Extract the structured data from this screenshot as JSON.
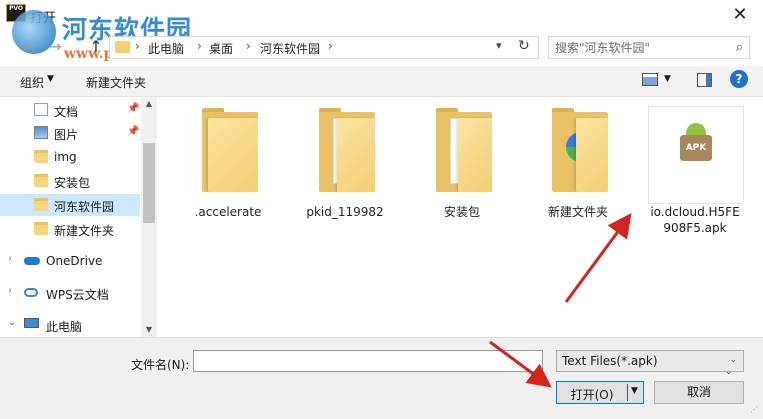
{
  "window": {
    "title": "打开",
    "app_icon_text": "PVO"
  },
  "watermark": {
    "site_name": "河东软件园",
    "url": "www.pc0359.cn"
  },
  "address": {
    "crumbs": [
      "此电脑",
      "桌面",
      "河东软件园"
    ]
  },
  "search": {
    "placeholder": "搜索\"河东软件园\""
  },
  "toolbar": {
    "organize_label": "组织",
    "new_folder_label": "新建文件夹"
  },
  "nav": {
    "items": [
      {
        "label": "文档",
        "icon": "document-icon",
        "pinned": true
      },
      {
        "label": "图片",
        "icon": "picture-icon",
        "pinned": true
      },
      {
        "label": "img",
        "icon": "folder-icon"
      },
      {
        "label": "安装包",
        "icon": "folder-icon"
      },
      {
        "label": "河东软件园",
        "icon": "folder-icon",
        "selected": true
      },
      {
        "label": "新建文件夹",
        "icon": "folder-icon"
      },
      {
        "label": "OneDrive",
        "icon": "cloud-icon"
      },
      {
        "label": "WPS云文档",
        "icon": "cloud-icon"
      },
      {
        "label": "此电脑",
        "icon": "computer-icon"
      }
    ]
  },
  "files": [
    {
      "name": ".accelerate",
      "type": "folder"
    },
    {
      "name": "pkid_119982",
      "type": "folder"
    },
    {
      "name": "安装包",
      "type": "folder"
    },
    {
      "name": "新建文件夹",
      "type": "folder"
    },
    {
      "name": "io.dcloud.H5FE908F5.apk",
      "name_line1": "io.dcloud.H5FE",
      "name_line2": "908F5.apk",
      "type": "apk",
      "icon_text": "APK"
    }
  ],
  "bottom": {
    "filename_label": "文件名(N):",
    "filename_value": "",
    "filetype_value": "Text Files(*.apk)",
    "open_label": "打开(O)",
    "cancel_label": "取消"
  },
  "colors": {
    "accent": "#0078d7",
    "selection": "#cce8ff",
    "annotation_arrow": "#d2231c"
  }
}
